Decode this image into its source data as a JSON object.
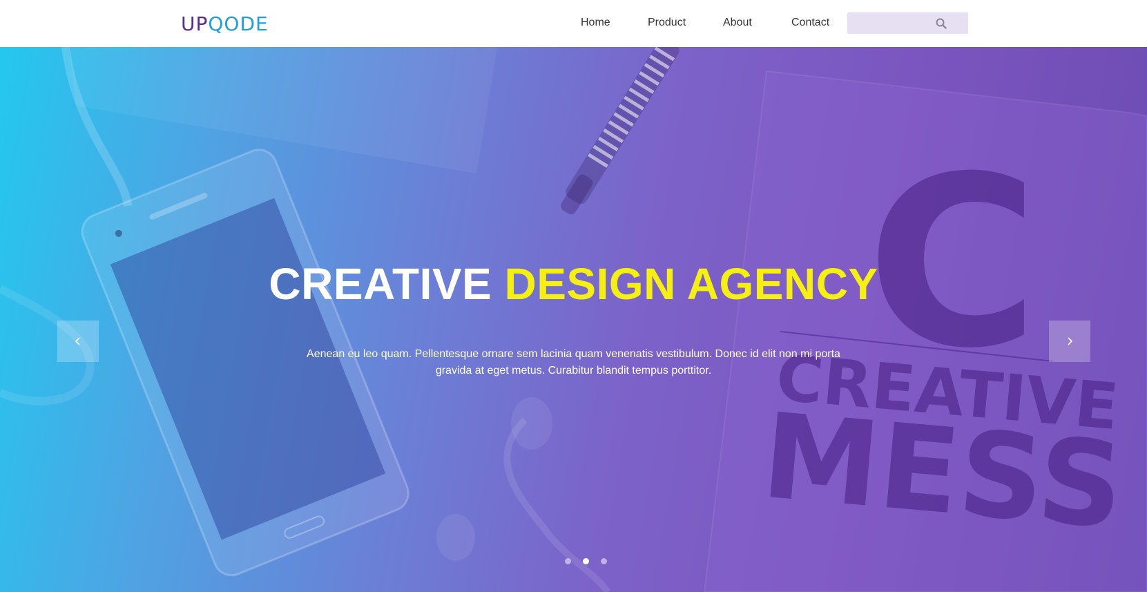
{
  "header": {
    "logo": {
      "part1": "UP",
      "part2": "QODE"
    },
    "nav": [
      {
        "label": "Home"
      },
      {
        "label": "Product"
      },
      {
        "label": "About"
      },
      {
        "label": "Contact"
      }
    ],
    "search": {
      "placeholder": "",
      "value": "",
      "icon": "search-icon"
    }
  },
  "hero": {
    "title_white": "CREATIVE",
    "title_accent": "DESIGN AGENCY",
    "text_line1": "Aenean eu leo quam. Pellentesque ornare sem lacinia quam venenatis vestibulum. Donec id elit non mi porta",
    "text_line2": "gravida at eget metus. Curabitur blandit tempus porttitor.",
    "prev_icon": "chevron-left-icon",
    "next_icon": "chevron-right-icon",
    "slides_total": 3,
    "active_slide": 2,
    "background_text": {
      "letter": "C",
      "word1": "CREATIVE",
      "word2": "MESS"
    }
  },
  "colors": {
    "accent": "#f6ef12",
    "logo_dark": "#5a2d8c",
    "logo_light": "#1fa0d8",
    "search_bg": "#e6e0f2"
  }
}
